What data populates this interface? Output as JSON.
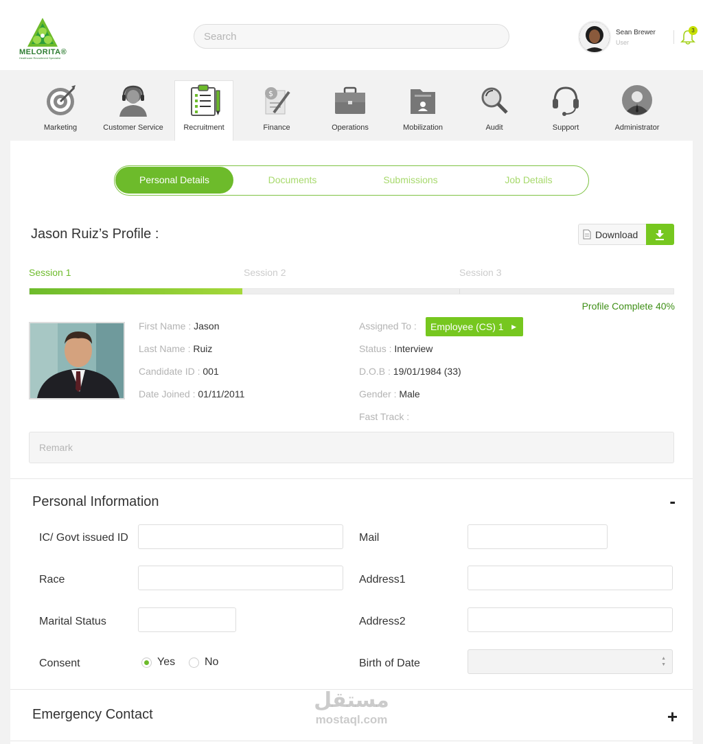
{
  "brand": {
    "name": "MELORITA®",
    "tagline": "Healthcare Recruitment Specialist"
  },
  "search": {
    "placeholder": "Search"
  },
  "user": {
    "name": "Sean Brewer",
    "role": "User",
    "notifications": "3"
  },
  "nav": [
    {
      "label": "Marketing",
      "icon": "target-icon"
    },
    {
      "label": "Customer Service",
      "icon": "agent-icon"
    },
    {
      "label": "Recruitment",
      "icon": "clipboard-icon"
    },
    {
      "label": "Finance",
      "icon": "finance-icon"
    },
    {
      "label": "Operations",
      "icon": "briefcase-icon"
    },
    {
      "label": "Mobilization",
      "icon": "folder-icon"
    },
    {
      "label": "Audit",
      "icon": "magnifier-icon"
    },
    {
      "label": "Support",
      "icon": "headset-icon"
    },
    {
      "label": "Administrator",
      "icon": "admin-icon"
    }
  ],
  "tabs": [
    "Personal Details",
    "Documents",
    "Submissions",
    "Job Details"
  ],
  "profile": {
    "title": "Jason Ruiz’s Profile :",
    "download_label": "Download",
    "sessions": [
      "Session 1",
      "Session 2",
      "Session 3"
    ],
    "progress_percent": 33,
    "complete_text": "Profile Complete 40%",
    "fields": {
      "first_name_label": "First Name :",
      "first_name": "Jason",
      "last_name_label": "Last Name :",
      "last_name": "Ruiz",
      "candidate_id_label": "Candidate ID :",
      "candidate_id": "001",
      "date_joined_label": "Date Joined :",
      "date_joined": "01/11/2011",
      "assigned_label": "Assigned To :",
      "assigned": "Employee (CS) 1",
      "status_label": "Status :",
      "status": "Interview",
      "dob_label": "D.O.B :",
      "dob": "19/01/1984 (33)",
      "gender_label": "Gender :",
      "gender": "Male",
      "fast_track_label": "Fast Track :"
    },
    "remark_placeholder": "Remark"
  },
  "personal_info": {
    "title": "Personal Information",
    "toggle": "-",
    "labels": {
      "ic": "IC/ Govt issued ID",
      "race": "Race",
      "marital": "Marital Status",
      "consent": "Consent",
      "mail": "Mail",
      "address1": "Address1",
      "address2": "Address2",
      "birth": "Birth of Date"
    },
    "consent_yes": "Yes",
    "consent_no": "No",
    "consent_value": "Yes"
  },
  "emergency": {
    "title": "Emergency Contact",
    "toggle": "+"
  },
  "watermark": {
    "arabic": "مستقل",
    "latin": "mostaql.com"
  },
  "colors": {
    "accent": "#6dbb2b",
    "accent_light": "#a7d96c",
    "complete": "#3f8f17"
  }
}
